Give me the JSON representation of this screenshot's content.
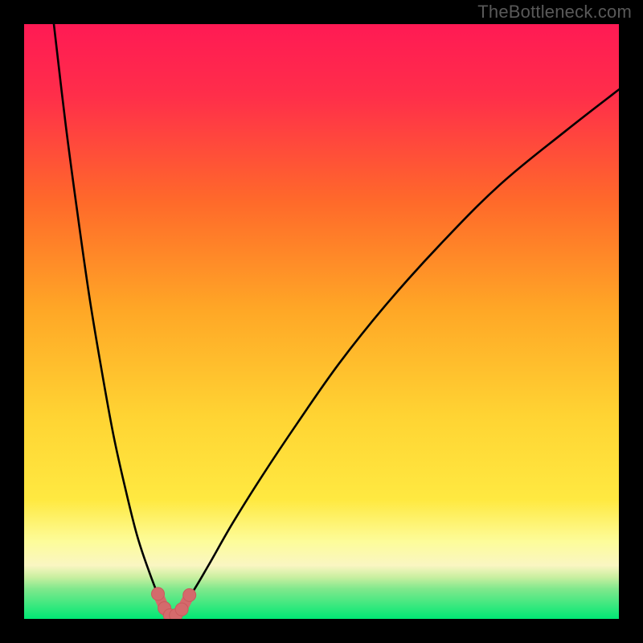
{
  "watermark": "TheBottleneck.com",
  "colors": {
    "frame": "#000000",
    "gradient_top": "#ff1a54",
    "gradient_mid1": "#ff6a2a",
    "gradient_mid2": "#ffe039",
    "gradient_band": "#fdfc9a",
    "gradient_bottom": "#00e874",
    "curve": "#000000",
    "marker_fill": "#d46a6c",
    "marker_stroke": "#c95a5c"
  },
  "chart_data": {
    "type": "line",
    "title": "",
    "xlabel": "",
    "ylabel": "",
    "xlim": [
      0,
      100
    ],
    "ylim": [
      0,
      100
    ],
    "notch_x": 25,
    "left_curve": {
      "x": [
        5,
        7,
        9,
        11,
        13,
        15,
        17,
        19,
        21,
        23,
        25
      ],
      "y": [
        100,
        83,
        68,
        54,
        42,
        31,
        22,
        14,
        8,
        3,
        0
      ]
    },
    "right_curve": {
      "x": [
        25,
        28,
        31,
        35,
        40,
        46,
        53,
        61,
        70,
        80,
        91,
        100
      ],
      "y": [
        0,
        4,
        9,
        16,
        24,
        33,
        43,
        53,
        63,
        73,
        82,
        89
      ]
    },
    "markers": {
      "x": [
        22.5,
        23.6,
        24.5,
        25.5,
        26.5,
        27.8
      ],
      "y": [
        4.2,
        1.8,
        0.6,
        0.6,
        1.6,
        4.0
      ]
    }
  }
}
